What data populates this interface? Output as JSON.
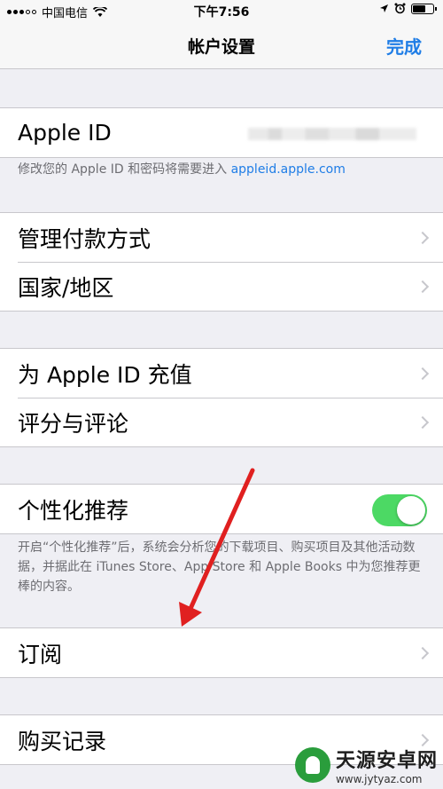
{
  "status_bar": {
    "carrier": "中国电信",
    "time": "下午7:56",
    "icons": [
      "signal-dots-icon",
      "wifi-icon",
      "location-icon",
      "alarm-icon",
      "battery-icon"
    ]
  },
  "nav": {
    "title": "帐户设置",
    "done_label": "完成"
  },
  "apple_id": {
    "label": "Apple ID",
    "note_prefix": "修改您的 Apple ID 和密码将需要进入 ",
    "note_link": "appleid.apple.com"
  },
  "payment_group": [
    {
      "label": "管理付款方式"
    },
    {
      "label": "国家/地区"
    }
  ],
  "topup_group": [
    {
      "label": "为 Apple ID 充值"
    },
    {
      "label": "评分与评论"
    }
  ],
  "personalization": {
    "label": "个性化推荐",
    "enabled": true,
    "note": "开启“个性化推荐”后，系统会分析您的下载项目、购买项目及其他活动数据，并据此在 iTunes Store、App Store 和 Apple Books 中为您推荐更棒的内容。"
  },
  "subscriptions": {
    "label": "订阅"
  },
  "purchase_history": {
    "label": "购买记录"
  },
  "watermark": {
    "title": "天源安卓网",
    "url": "www.jytyaz.com"
  },
  "colors": {
    "accent": "#1f7de6",
    "toggle_on": "#4cd964",
    "background": "#efeff4",
    "annotation_arrow": "#e02020"
  }
}
